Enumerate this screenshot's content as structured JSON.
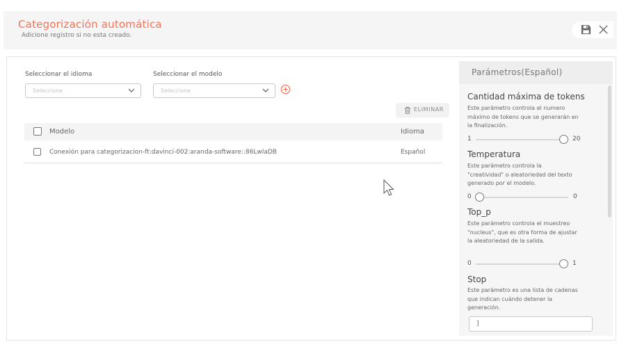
{
  "header": {
    "title": "Categorización automática",
    "subtitle": "Adicione registro si no esta creado."
  },
  "form": {
    "language_label": "Seleccionar el idioma",
    "language_placeholder": "Seleccione",
    "model_label": "Seleccionar el modelo",
    "model_placeholder": "Seleccione",
    "delete_label": "ELIMINAR"
  },
  "table": {
    "columns": [
      "Modelo",
      "Idioma"
    ],
    "rows": [
      {
        "model": "Conexión para categorizacion-ft:davinci-002:aranda-software::86LwlaDB",
        "language": "Español"
      }
    ]
  },
  "params": {
    "title": "Parámetros(Español)",
    "items": [
      {
        "name": "Cantidad máxima de tokens",
        "description": "Este parámetro controla el numero máximo de tokens que se generarán en la finalización.",
        "min": "1",
        "max": "20",
        "value": 20
      },
      {
        "name": "Temperatura",
        "description": "Este parámetro controla la \"creatividad\" o aleatoriedad del texto generado por el modelo.",
        "min": "0",
        "max": "0",
        "value": 0
      },
      {
        "name": "Top_p",
        "description": "Este parámetro controla el muestreo \"nucleus\", que es otra forma de ajustar la aleatoriedad de la salida.",
        "min": "0",
        "max": "1",
        "value": 1
      },
      {
        "name": "Stop",
        "description": "Este parámetro es una lista de cadenas que indican cuándo detener la generación.",
        "value": "]"
      }
    ]
  },
  "colors": {
    "accent": "#ee7459",
    "header_bg": "#f5f5f5"
  },
  "icons": [
    "save-icon",
    "close-icon",
    "chevron-down-icon",
    "add-circle-icon",
    "trash-icon",
    "mouse-cursor-icon"
  ]
}
